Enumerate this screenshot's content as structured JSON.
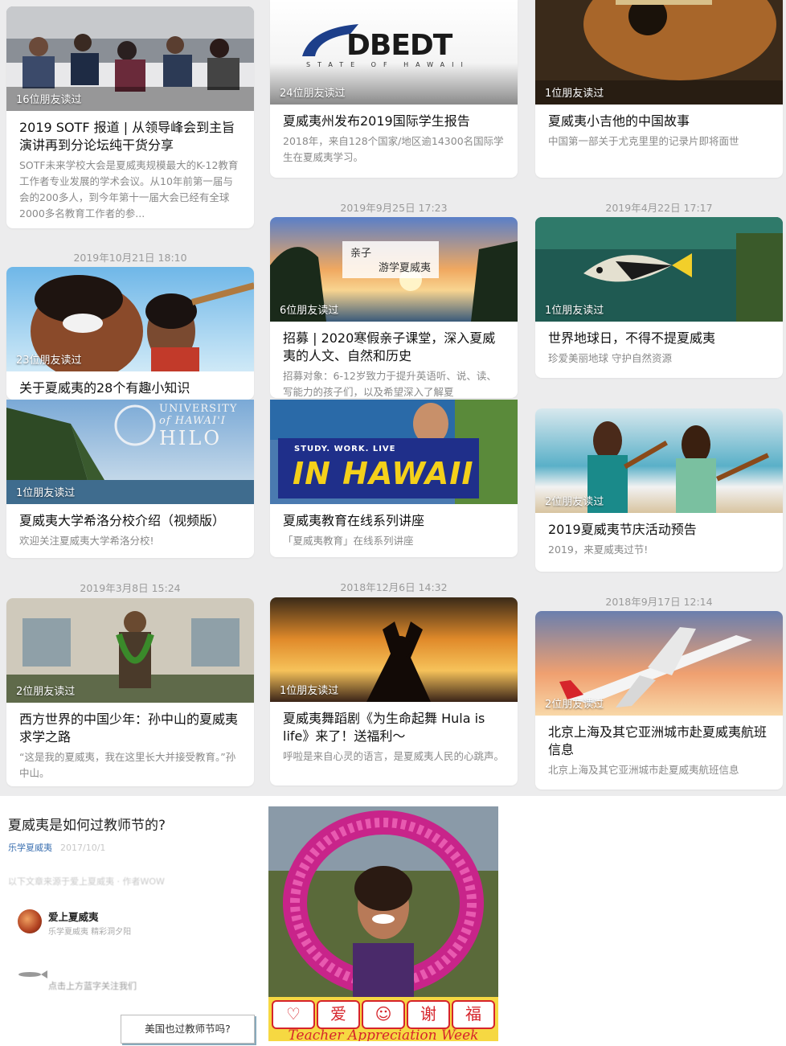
{
  "columns": [
    {
      "cards": [
        {
          "badge": "16位朋友读过",
          "title": "2019 SOTF 报道 | 从领导峰会到主旨演讲再到分论坛纯干货分享",
          "desc": "SOTF未来学校大会是夏威夷规模最大的K-12教育工作者专业发展的学术会议。从10年前第一届与会的200多人，到今年第十一届大会已经有全球2000多名教育工作者的参..."
        },
        {
          "date": "2019年10月21日 18:10",
          "badge": "23位朋友读过",
          "title": "关于夏威夷的28个有趣小知识",
          "desc": ""
        },
        {
          "badge": "1位朋友读过",
          "title": "夏威夷大学希洛分校介绍（视频版）",
          "desc": "欢迎关注夏威夷大学希洛分校!",
          "logo": [
            "UNIVERSITY",
            "of HAWAI'I",
            "HILO"
          ]
        },
        {
          "date": "2019年3月8日 15:24",
          "badge": "2位朋友读过",
          "title": "西方世界的中国少年：孙中山的夏威夷求学之路",
          "desc": "“这是我的夏威夷，我在这里长大并接受教育。”孙中山。"
        }
      ]
    },
    {
      "cards": [
        {
          "badge": "24位朋友读过",
          "title": "夏威夷州发布2019国际学生报告",
          "desc": "2018年，来自128个国家/地区逾14300名国际学生在夏威夷学习。",
          "logo": [
            "DBEDT",
            "STATE OF HAWAII"
          ]
        },
        {
          "date": "2019年9月25日 17:23",
          "badge": "6位朋友读过",
          "title": "招募 | 2020寒假亲子课堂，深入夏威夷的人文、自然和历史",
          "desc": "招募对象：6-12岁致力于提升英语听、说、读、写能力的孩子们，以及希望深入了解夏",
          "overlay": [
            "亲子",
            "游学夏威夷"
          ]
        },
        {
          "badge": "",
          "title": "夏威夷教育在线系列讲座",
          "desc": "「夏威夷教育」在线系列讲座",
          "overlay": [
            "STUDY. WORK. LIVE",
            "IN HAWAII"
          ]
        },
        {
          "date": "2018年12月6日 14:32",
          "badge": "1位朋友读过",
          "title": "夏威夷舞蹈剧《为生命起舞 Hula is life》来了！送福利～",
          "desc": "呼啦是来自心灵的语言，是夏威夷人民的心跳声。"
        }
      ]
    },
    {
      "cards": [
        {
          "badge": "1位朋友读过",
          "title": "夏威夷小吉他的中国故事",
          "desc": "中国第一部关于尤克里里的记录片即将面世"
        },
        {
          "date": "2019年4月22日 17:17",
          "badge": "1位朋友读过",
          "title": "世界地球日，不得不提夏威夷",
          "desc": "珍爱美丽地球 守护自然资源"
        },
        {
          "badge": "2位朋友读过",
          "title": "2019夏威夷节庆活动预告",
          "desc": "2019，来夏威夷过节!"
        },
        {
          "date": "2018年9月17日 12:14",
          "badge": "2位朋友读过",
          "title": "北京上海及其它亚洲城市赴夏威夷航班信息",
          "desc": "北京上海及其它亚洲城市赴夏威夷航班信息"
        }
      ]
    }
  ],
  "article": {
    "title": "夏威夷是如何过教师节的?",
    "source": "乐学夏威夷",
    "source_extra": "2017/10/1",
    "blurred_line": "以下文章来源于爱上夏威夷 · 作者WOW",
    "account_name": "爱上夏威夷",
    "account_sub": "乐学夏威夷 精彩洞夕阳",
    "follow_hint": "点击上方蓝字关注我们",
    "button": "美国也过教师节吗?"
  },
  "teacher_banner": {
    "symbols": [
      "♡",
      "爱",
      "☺",
      "谢",
      "福"
    ],
    "text": "Teacher Appreciation Week"
  }
}
